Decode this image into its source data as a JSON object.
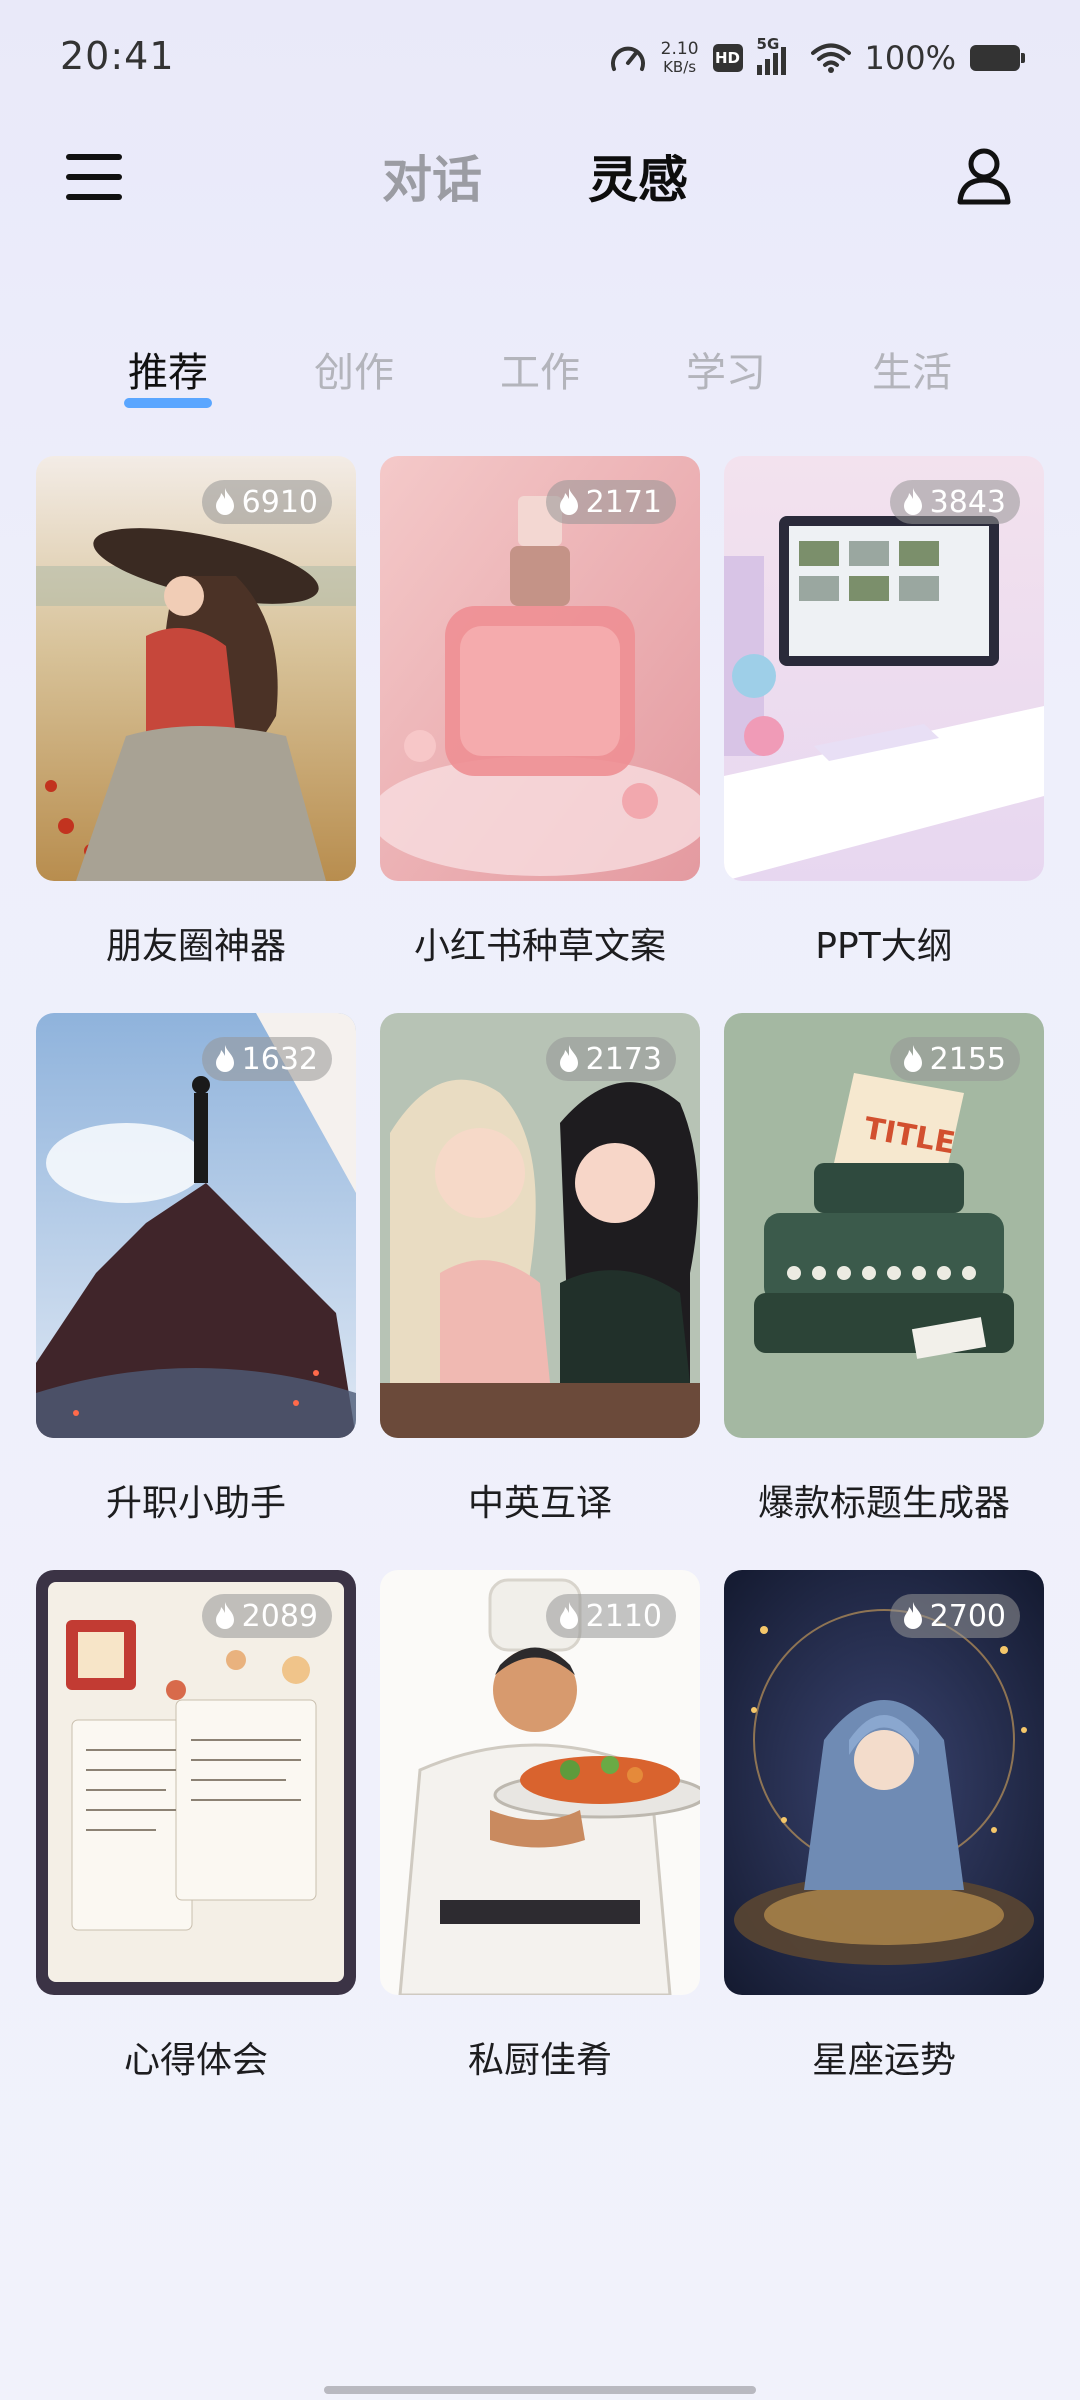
{
  "status_bar": {
    "time": "20:41",
    "net_speed_value": "2.10",
    "net_speed_unit": "KB/s",
    "hd": "HD",
    "network": "5G",
    "battery": "100%"
  },
  "header": {
    "tab_chat": "对话",
    "tab_inspiration": "灵感"
  },
  "category_tabs": [
    {
      "label": "推荐",
      "active": true
    },
    {
      "label": "创作",
      "active": false
    },
    {
      "label": "工作",
      "active": false
    },
    {
      "label": "学习",
      "active": false
    },
    {
      "label": "生活",
      "active": false
    }
  ],
  "cards": [
    {
      "title": "朋友圈神器",
      "count": "6910",
      "image": "girl-in-field"
    },
    {
      "title": "小红书种草文案",
      "count": "2171",
      "image": "perfume-bottle"
    },
    {
      "title": "PPT大纲",
      "count": "3843",
      "image": "computer-desk"
    },
    {
      "title": "升职小助手",
      "count": "1632",
      "image": "man-on-rock"
    },
    {
      "title": "中英互译",
      "count": "2173",
      "image": "two-girls"
    },
    {
      "title": "爆款标题生成器",
      "count": "2155",
      "image": "typewriter"
    },
    {
      "title": "心得体会",
      "count": "2089",
      "image": "journal-notebook"
    },
    {
      "title": "私厨佳肴",
      "count": "2110",
      "image": "chef-with-dish"
    },
    {
      "title": "星座运势",
      "count": "2700",
      "image": "zodiac-girl"
    }
  ],
  "colors": {
    "accent": "#5aa6ff",
    "inactive_text": "#9b9ca3"
  }
}
